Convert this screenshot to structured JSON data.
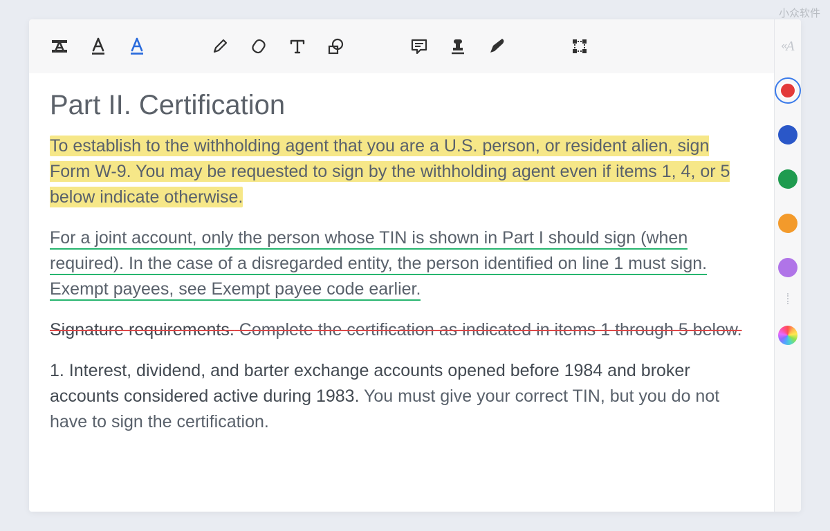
{
  "watermark": "小众软件",
  "toolbar": {
    "highlight_style": "text-style",
    "underline": "underline",
    "underline_active": "underline-color",
    "pencil": "draw",
    "eraser": "erase",
    "text": "insert-text",
    "shape": "shape",
    "note": "sticky-note",
    "stamp": "stamp",
    "pen": "signature",
    "crop": "select-area"
  },
  "side_label_glyph": "A",
  "colors": {
    "red": "#e33a3a",
    "blue": "#2a57c8",
    "green": "#1f9b4f",
    "orange": "#f39a2b",
    "purple": "#b074e8",
    "custom": "gradient"
  },
  "selected_color": "red",
  "document": {
    "title": "Part II. Certification",
    "p1": "To establish to the withholding agent that you are a U.S. person, or resident alien, sign Form W-9. You may be requested to sign by the withholding agent even if items 1, 4, or 5 below indicate otherwise.",
    "p2": "For a joint account, only the person whose TIN is shown in Part I should sign (when required). In the case of a disregarded entity, the person identified on line 1 must sign. Exempt payees, see Exempt payee code earlier.",
    "p3_a": "Signature requirements.",
    "p3_b": " Complete the certification as indicated in items 1 through 5 below.",
    "p4_a": "1. Interest, dividend, and barter exchange accounts opened before 1984 and broker accounts considered active during 1983.",
    "p4_b": " You must give your correct TIN, but you do not have to sign the certification."
  }
}
